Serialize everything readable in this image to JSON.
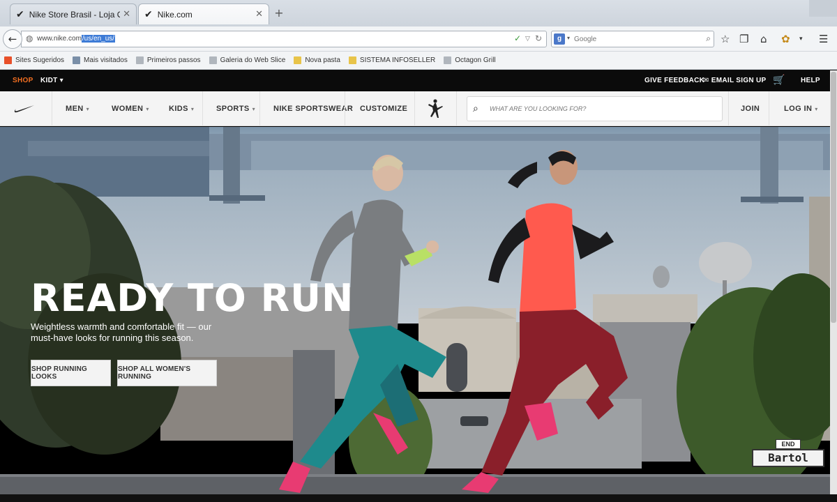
{
  "browser": {
    "tabs": [
      {
        "title": "Nike Store Brasil - Loja Ofici...",
        "favicon": "nike-swoosh-icon",
        "active": false
      },
      {
        "title": "Nike.com",
        "favicon": "nike-swoosh-icon",
        "active": true
      }
    ],
    "url": {
      "host": "www.nike.com",
      "selected_path": "/us/en_us/"
    },
    "search": {
      "engine": "Google",
      "engine_icon": "g",
      "placeholder": "Google"
    },
    "bookmarks": [
      {
        "label": "Sites Sugeridos",
        "color": "#e8502a"
      },
      {
        "label": "Mais visitados",
        "color": "#7a8fa8"
      },
      {
        "label": "Primeiros passos",
        "color": "#b0b6bd"
      },
      {
        "label": "Galeria do Web Slice",
        "color": "#b0b6bd"
      },
      {
        "label": "Nova pasta",
        "color": "#e8c44a"
      },
      {
        "label": "SISTEMA INFOSELLER",
        "color": "#e8c44a"
      },
      {
        "label": "Octagon Grill",
        "color": "#b0b6bd"
      }
    ]
  },
  "site": {
    "topbar": {
      "shop_label": "SHOP",
      "kids_label": "KIDT",
      "feedback_label": "GIVE FEEDBACK",
      "email_label": "EMAIL SIGN UP",
      "help_label": "HELP"
    },
    "nav": {
      "items": [
        "MEN",
        "WOMEN",
        "KIDS",
        "SPORTS",
        "NIKE SPORTSWEAR",
        "CUSTOMIZE"
      ],
      "search_placeholder": "WHAT ARE YOU LOOKING FOR?",
      "join_label": "JOIN",
      "login_label": "LOG IN"
    },
    "hero": {
      "title": "READY TO RUN",
      "subtitle": "Weightless warmth and comfortable fit — our must-have looks for running this season.",
      "button_1": "SHOP RUNNING LOOKS",
      "button_2": "SHOP ALL WOMEN'S RUNNING",
      "street_sign_top": "END",
      "street_sign_name": "Bartol"
    }
  },
  "colors": {
    "accent_orange": "#f36f21",
    "topbar_bg": "#0b0b0b",
    "nav_bg": "#f4f4f4"
  }
}
